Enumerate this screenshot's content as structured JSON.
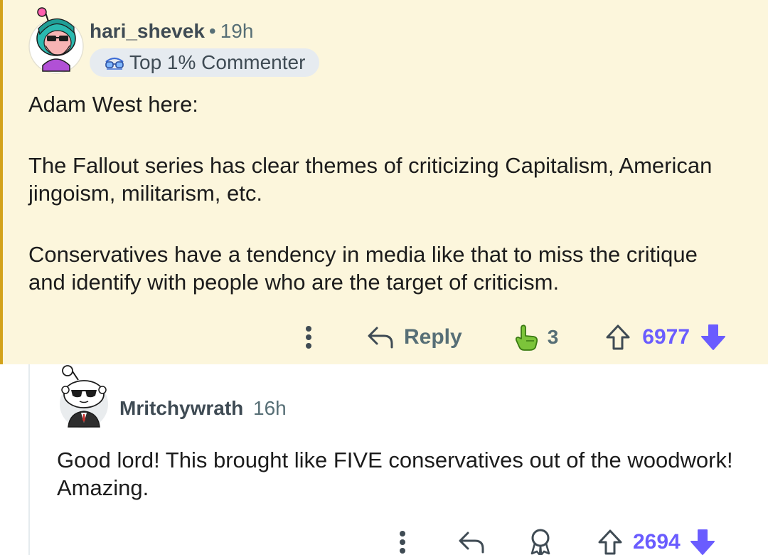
{
  "comments": [
    {
      "author": "hari_shevek",
      "separator": "•",
      "time": "19h",
      "flair": "Top 1% Commenter",
      "paragraphs": [
        "Adam West here:",
        "The Fallout series has clear themes of criticizing Capitalism, American jingoism, militarism, etc.",
        "Conservatives have a tendency in media like that to miss the critique and identify with people who are the target of criticism."
      ],
      "reply_label": "Reply",
      "award_count": "3",
      "score": "6977"
    },
    {
      "author": "Mritchywrath",
      "time": "16h",
      "paragraphs": [
        "Good lord! This brought like FIVE conservatives out of the woodwork! Amazing."
      ],
      "score": "2694"
    }
  ],
  "colors": {
    "highlight_bg": "#fcf6dc",
    "highlight_border": "#d3a21a",
    "vote_accent": "#6a5cff",
    "muted_text": "#576f76"
  },
  "icons": {
    "more": "more-vertical-icon",
    "reply": "reply-arrow-icon",
    "award": "award-hand-icon",
    "award_outline": "award-ribbon-icon",
    "upvote": "upvote-arrow-icon",
    "downvote": "downvote-arrow-icon",
    "flair": "glasses-icon"
  }
}
